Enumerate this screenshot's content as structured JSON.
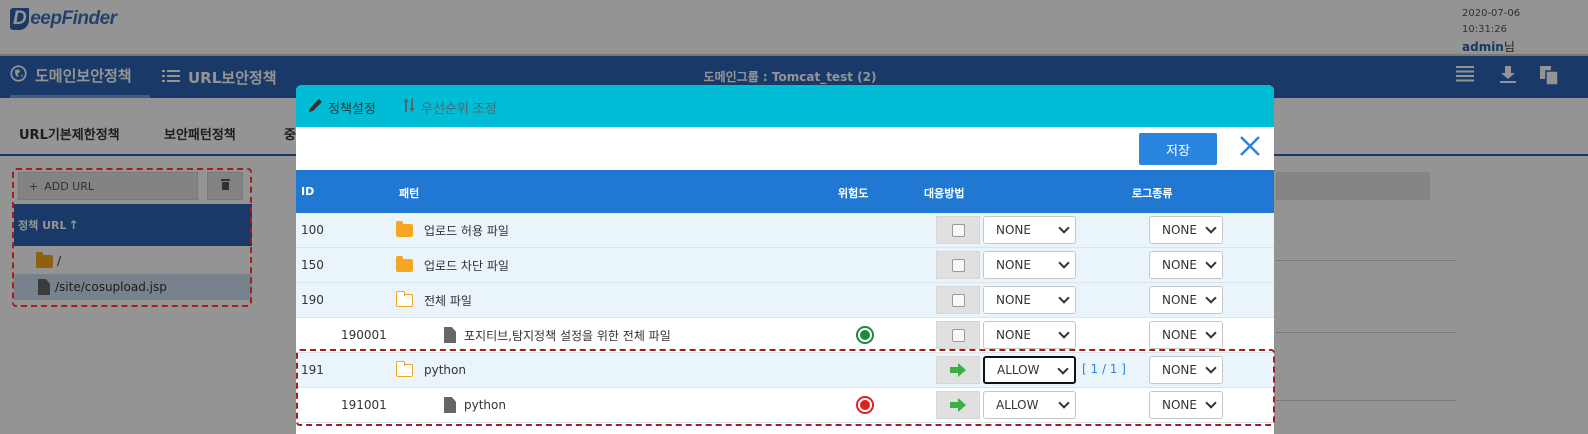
{
  "header": {
    "logo_text": "eepFinder",
    "logo_letter": "D",
    "date": "2020-07-06",
    "time": "10:31:26",
    "user": "admin",
    "user_suffix": "님"
  },
  "nav": {
    "items": [
      {
        "label": "도메인보안정책",
        "icon": "globe-icon",
        "active": true
      },
      {
        "label": "URL보안정책",
        "icon": "list-icon",
        "active": false
      }
    ],
    "center_title": "도메인그룹 : Tomcat_test (2)",
    "right_icons": [
      "menu-lines-icon",
      "download-icon",
      "copy-icon"
    ]
  },
  "subtabs": [
    "URL기본제한정책",
    "보안패턴정책",
    "중"
  ],
  "left_panel": {
    "add_label": "ADD URL",
    "add_icon": "plus-icon",
    "delete_icon": "trash-icon",
    "header_label": "정책 URL",
    "header_icon": "sort-up-icon",
    "items": [
      {
        "label": "/",
        "icon": "folder-icon",
        "selected": false
      },
      {
        "label": "/site/cosupload.jsp",
        "icon": "file-icon",
        "selected": true
      }
    ]
  },
  "modal": {
    "tabs": [
      {
        "label": "정책설정",
        "icon": "pencil-icon"
      },
      {
        "label": "우선순위 조정",
        "icon": "sort-arrows-icon"
      }
    ],
    "save_label": "저장",
    "close_icon": "close-icon",
    "columns": {
      "id": "ID",
      "pattern": "패턴",
      "risk": "위험도",
      "action": "대응방법",
      "log": "로그종류"
    },
    "rows": [
      {
        "id": "100",
        "pattern": "업로드 허용 파일",
        "icon": "folder-filled",
        "risk": "",
        "action_icon": "checkbox",
        "action": "NONE",
        "log": "NONE",
        "page": "",
        "alt": true
      },
      {
        "id": "150",
        "pattern": "업로드 차단 파일",
        "icon": "folder-filled",
        "risk": "",
        "action_icon": "checkbox",
        "action": "NONE",
        "log": "NONE",
        "page": "",
        "alt": true
      },
      {
        "id": "190",
        "pattern": "전체 파일",
        "icon": "folder-outline",
        "risk": "",
        "action_icon": "checkbox",
        "action": "NONE",
        "log": "NONE",
        "page": "",
        "alt": true
      },
      {
        "id": "190001",
        "pattern": "포지티브,탐지정책 설정을 위한 전체 파일",
        "icon": "file",
        "risk": "green",
        "action_icon": "checkbox",
        "action": "NONE",
        "log": "NONE",
        "page": "",
        "alt": false
      },
      {
        "id": "191",
        "pattern": "python",
        "icon": "folder-outline",
        "risk": "",
        "action_icon": "arrow",
        "action": "ALLOW",
        "log": "NONE",
        "page": "[ 1 / 1 ]",
        "alt": true
      },
      {
        "id": "191001",
        "pattern": "python",
        "icon": "file",
        "risk": "red",
        "action_icon": "arrow",
        "action": "ALLOW",
        "log": "NONE",
        "page": "",
        "alt": false
      }
    ],
    "risk_colors": {
      "green": "#1e8a3a",
      "red": "#e0201f"
    },
    "accent": "#2178d2",
    "arrow_color": "#3cb043"
  }
}
